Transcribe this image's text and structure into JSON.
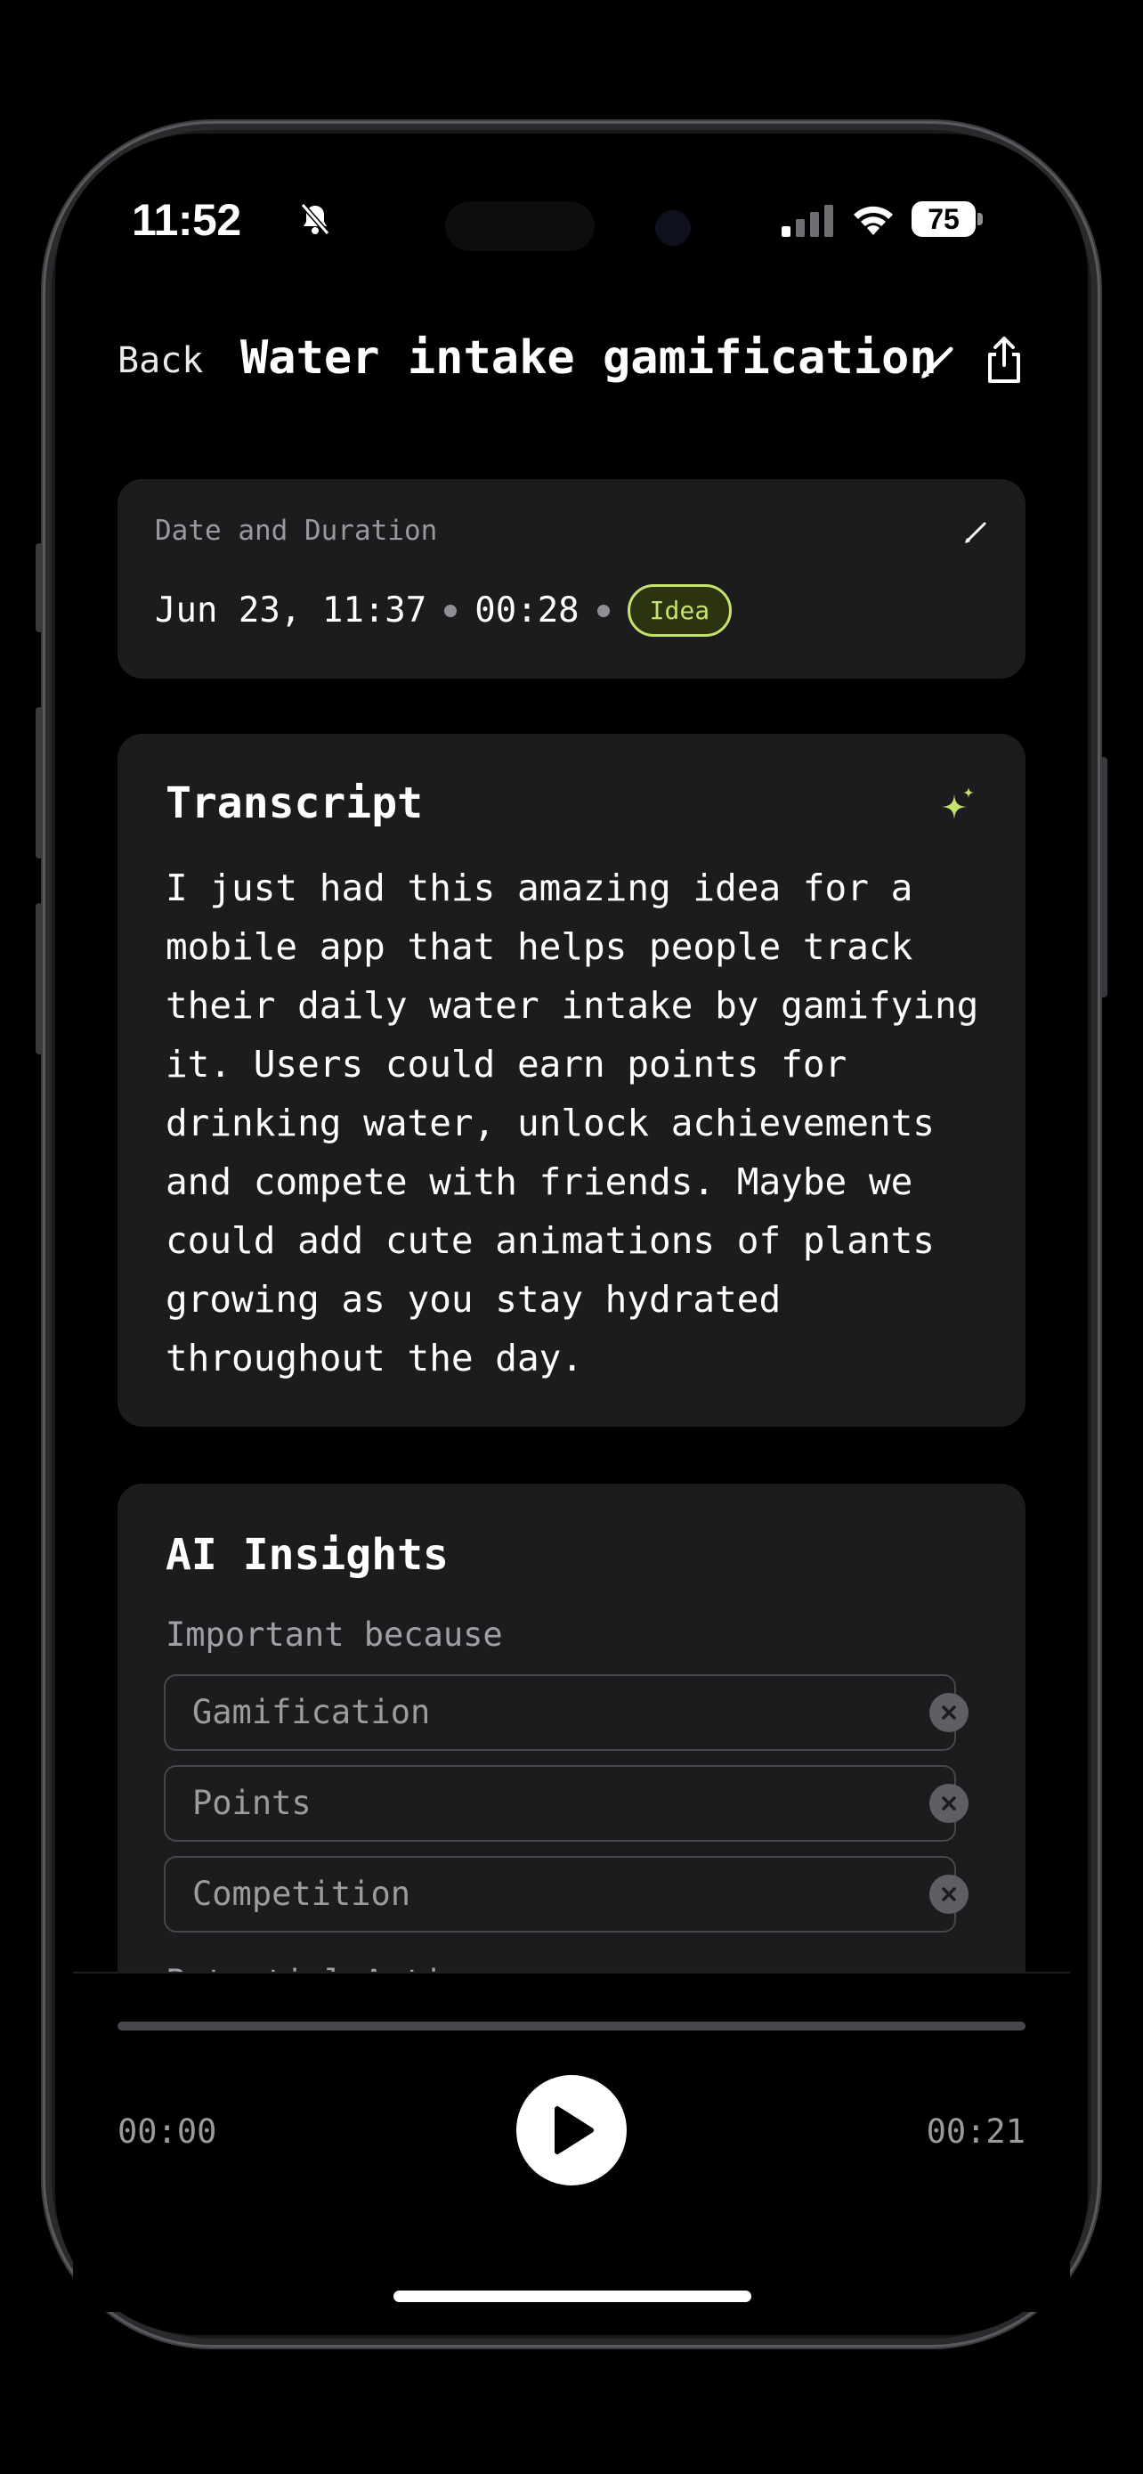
{
  "status_bar": {
    "time": "11:52",
    "battery": "75",
    "icons": [
      "bell-slash-icon",
      "signal-icon",
      "wifi-icon",
      "battery-icon"
    ]
  },
  "header": {
    "back_label": "Back",
    "title": "Water intake gamification",
    "icons": [
      "pencil-icon",
      "share-icon"
    ]
  },
  "date_card": {
    "label": "Date and Duration",
    "date": "Jun 23, 11:37",
    "duration": "00:28",
    "tag": "Idea"
  },
  "transcript": {
    "title": "Transcript",
    "text": "I just had this amazing idea for a mobile app that helps people track their daily water intake by gamifying it. Users could earn points for drinking water, unlock achievements and compete with friends. Maybe we could add cute animations of plants growing as you stay hydrated throughout the day."
  },
  "ai_insights": {
    "title": "AI Insights",
    "important_label": "Important because",
    "items": [
      "Gamification",
      "Points",
      "Competition"
    ],
    "next_section_label": "Potential Acti"
  },
  "player": {
    "current_time": "00:00",
    "total_time": "00:21",
    "progress": 0
  },
  "colors": {
    "accent": "#c5e36b",
    "card_bg": "#1c1c1e",
    "background": "#000000"
  }
}
